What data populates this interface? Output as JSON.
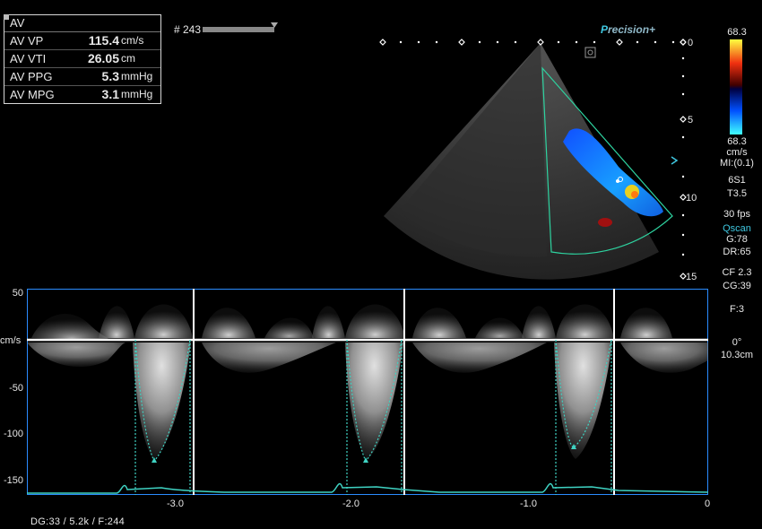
{
  "measurements": {
    "title": "AV",
    "rows": [
      {
        "label": "AV VP",
        "value": "115.4",
        "unit": "cm/s"
      },
      {
        "label": "AV VTI",
        "value": "26.05",
        "unit": "cm"
      },
      {
        "label": "AV PPG",
        "value": "5.3",
        "unit": "mmHg"
      },
      {
        "label": "AV MPG",
        "value": "3.1",
        "unit": "mmHg"
      }
    ]
  },
  "frame": {
    "label": "# 243"
  },
  "brand": {
    "prefix": "P",
    "rest": "recision",
    "suffix": "+"
  },
  "color_scale": {
    "top": "68.3",
    "bottom": "68.3",
    "unit": "cm/s",
    "pos_color": "#f03010",
    "neg_color": "#00a0ff"
  },
  "depth_marks": [
    "0",
    "5",
    "10",
    "15"
  ],
  "right_panel": {
    "mi": "MI:(0.1)",
    "probe": "6S1",
    "thermal": "T3.5",
    "fps": "30 fps",
    "qscan": "Qscan",
    "gain": "G:78",
    "dr": "DR:65",
    "cf": "CF 2.3",
    "cg": "CG:39",
    "f": "F:3",
    "angle": "0°",
    "depth": "10.3cm"
  },
  "doppler": {
    "y_unit": "cm/s",
    "y_ticks": [
      "50",
      "-50",
      "-100",
      "-150"
    ],
    "x_ticks": [
      "-3.0",
      "-2.0",
      "-1.0",
      "0"
    ],
    "trace_color": "#3fd3c3",
    "baseline_color": "#ffffff"
  },
  "bottom_info": "DG:33   / 5.2k     / F:244"
}
